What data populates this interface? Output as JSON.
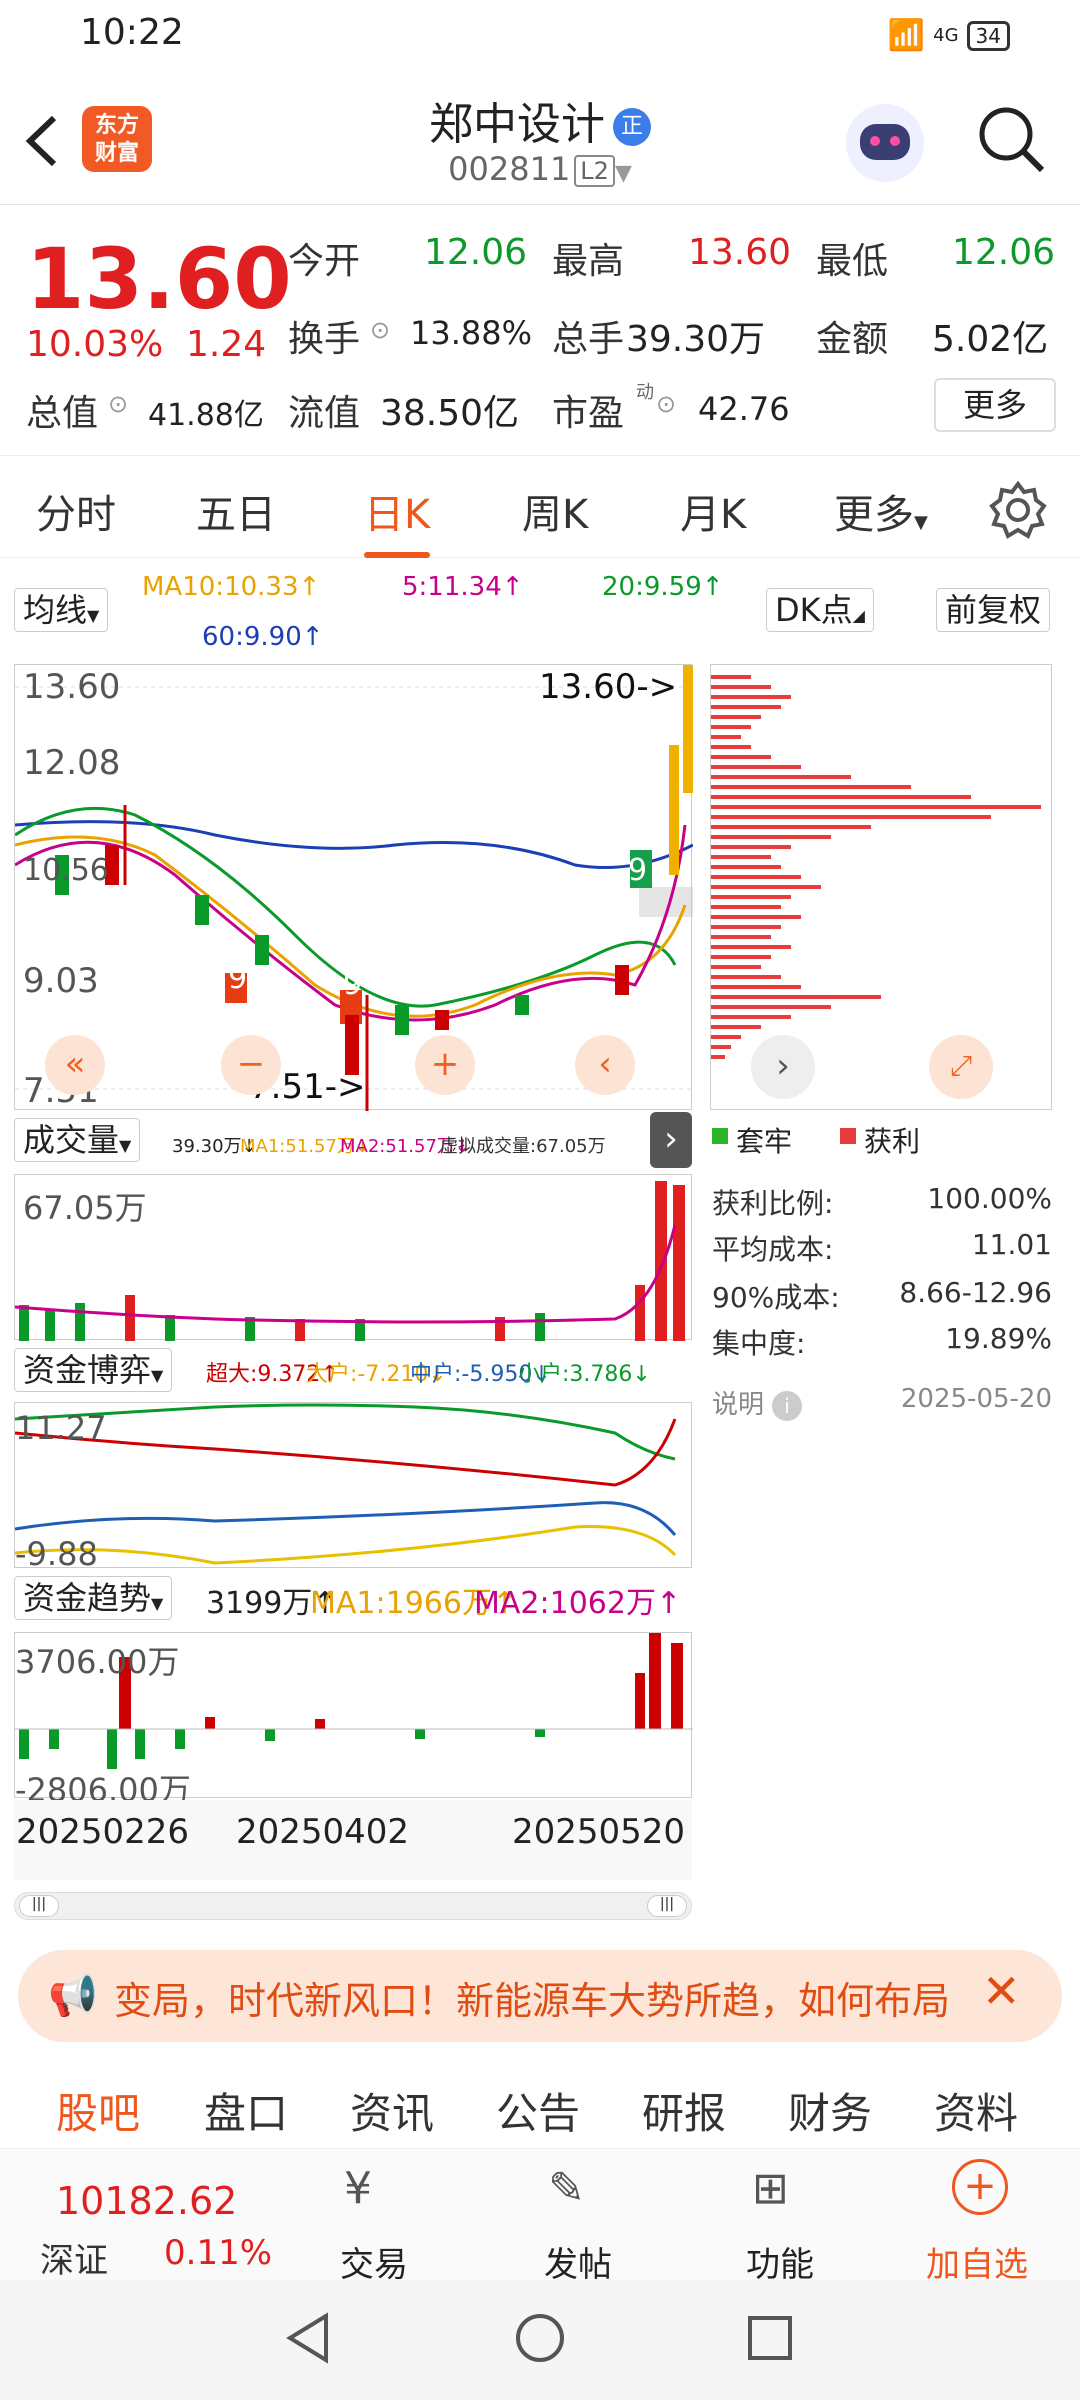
{
  "status": {
    "time": "10:22",
    "net": "4G",
    "battery": "34"
  },
  "header": {
    "logo": "东方\n财富",
    "name": "郑中设计",
    "badge": "正",
    "code": "002811",
    "level": "L2"
  },
  "quote": {
    "price": "13.60",
    "pct": "10.03%",
    "chg": "1.24",
    "r1": [
      {
        "label": "今开",
        "value": "12.06",
        "c": "green"
      },
      {
        "label": "最高",
        "value": "13.60",
        "c": "red"
      },
      {
        "label": "最低",
        "value": "12.06",
        "c": "green"
      }
    ],
    "r2": [
      {
        "label": "换手",
        "value": "13.88%"
      },
      {
        "label": "总手",
        "value": "39.30万"
      },
      {
        "label": "金额",
        "value": "5.02亿"
      }
    ],
    "r3": [
      {
        "label": "总值",
        "value": "41.88亿"
      },
      {
        "label": "流值",
        "value": "38.50亿"
      },
      {
        "label": "市盈",
        "sup": "动",
        "value": "42.76"
      }
    ],
    "more": "更多"
  },
  "tabs": [
    "分时",
    "五日",
    "日K",
    "周K",
    "月K",
    "更多"
  ],
  "ma": {
    "sel": "均线",
    "ma10": "MA10:10.33↑",
    "ma5": "5:11.34↑",
    "ma20": "20:9.59↑",
    "ma60": "60:9.90↑",
    "dk": "DK点",
    "fq": "前复权"
  },
  "kchart": {
    "top": "13.60",
    "l2": "12.08",
    "l3": "10.56",
    "l4": "9.03",
    "bot": "7.51",
    "hi_tag": "13.60->",
    "lo_tag": "7.51->",
    "tag9": "9"
  },
  "chip": {
    "legend_a": "套牢",
    "legend_b": "获利",
    "rows": [
      {
        "k": "获利比例:",
        "v": "100.00%"
      },
      {
        "k": "平均成本:",
        "v": "11.01"
      },
      {
        "k": "90%成本:",
        "v": "8.66-12.96"
      },
      {
        "k": "集中度:",
        "v": "19.89%"
      }
    ],
    "note": "说明",
    "date": "2025-05-20"
  },
  "vol": {
    "sel": "成交量",
    "info": "39.30万↓",
    "ma1": "MA1:51.57万↓",
    "ma2": "MA2:51.57万↓",
    "virt": "虚拟成交量:67.05万",
    "top": "67.05万"
  },
  "fund": {
    "sel": "资金博弈",
    "a": "超大:9.372↑",
    "b": "大户:-7.210↓",
    "c": "中户:-5.950↓",
    "d": "小户:3.786↓",
    "top": "11.27",
    "bot": "-9.88"
  },
  "trend": {
    "sel": "资金趋势",
    "v": "3199万↑",
    "ma1": "MA1:1966万↑",
    "ma2": "MA2:1062万↑",
    "top": "3706.00万",
    "bot": "-2806.00万"
  },
  "dates": [
    "20250226",
    "20250402",
    "20250520"
  ],
  "banner": "变局，时代新风口！新能源车大势所趋，如何布局",
  "bottom_tabs": [
    "股吧",
    "盘口",
    "资讯",
    "公告",
    "研报",
    "财务",
    "资料"
  ],
  "footer": {
    "index": "10182.62",
    "name": "深证",
    "pct": "0.11%",
    "btns": [
      "交易",
      "发帖",
      "功能",
      "加自选"
    ]
  },
  "colors": {
    "accent": "#f0571c",
    "up": "#e02020",
    "down": "#0a9a2a"
  }
}
